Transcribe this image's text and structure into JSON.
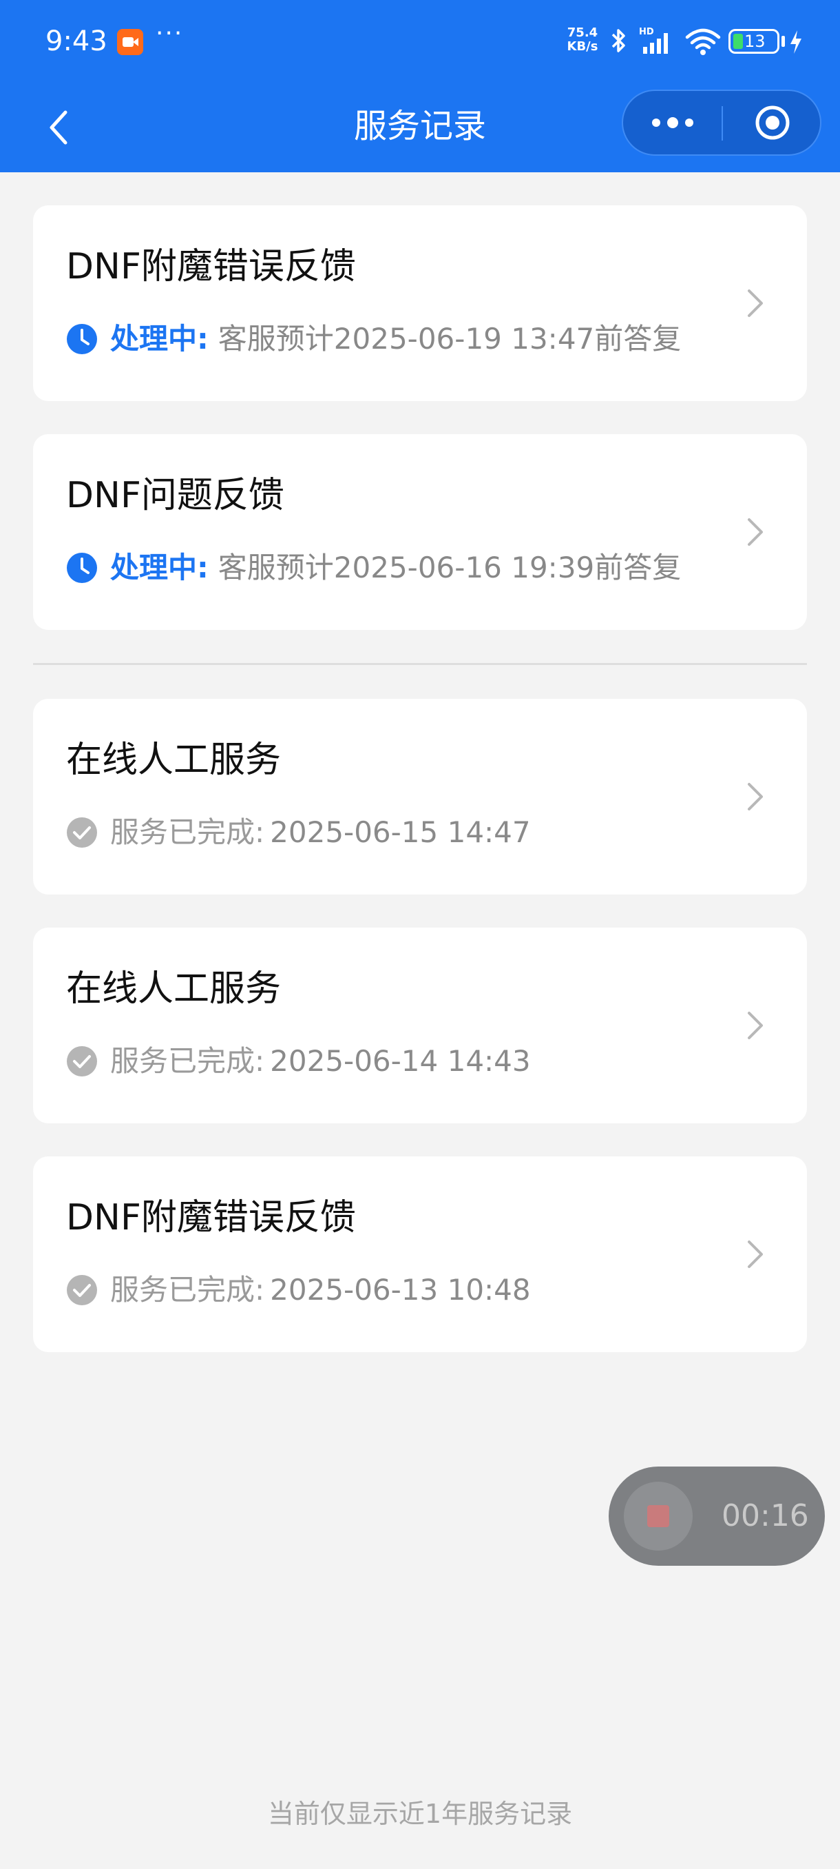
{
  "status_bar": {
    "time": "9:43",
    "more": "···",
    "net_speed_value": "75.4",
    "net_speed_unit": "KB/s",
    "battery_level": "13",
    "icons": [
      "recorder-app-icon",
      "bluetooth-icon",
      "hd-signal-icon",
      "wifi-icon",
      "battery-icon",
      "charging-icon"
    ]
  },
  "nav": {
    "title": "服务记录",
    "accent_color": "#1c75f2"
  },
  "records": [
    {
      "title": "DNF附魔错误反馈",
      "status": "in_progress",
      "status_label": "处理中:",
      "status_detail": "客服预计2025-06-19 13:47前答复"
    },
    {
      "title": "DNF问题反馈",
      "status": "in_progress",
      "status_label": "处理中:",
      "status_detail": "客服预计2025-06-16 19:39前答复"
    },
    {
      "title": "在线人工服务",
      "status": "completed",
      "status_label": "服务已完成:",
      "status_detail": "2025-06-15 14:47"
    },
    {
      "title": "在线人工服务",
      "status": "completed",
      "status_label": "服务已完成:",
      "status_detail": "2025-06-14 14:43"
    },
    {
      "title": "DNF附魔错误反馈",
      "status": "completed",
      "status_label": "服务已完成:",
      "status_detail": "2025-06-13 10:48"
    }
  ],
  "recording": {
    "elapsed": "00:16"
  },
  "footer_note": "当前仅显示近1年服务记录"
}
